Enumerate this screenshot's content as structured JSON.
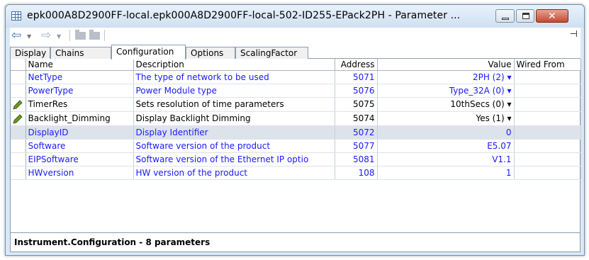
{
  "window": {
    "title": "epk000A8D2900FF-local.epk000A8D2900FF-local-502-ID255-EPack2PH - Parameter ...",
    "close_glyph": "✕"
  },
  "toolbar": {
    "back_glyph": "⇦",
    "forward_glyph": "⇨",
    "dropdown_glyph": "▼",
    "pin_glyph": "⊣"
  },
  "tabs": [
    {
      "label": "Display"
    },
    {
      "label": "Chains"
    },
    {
      "label": "Configuration"
    },
    {
      "label": "Options"
    },
    {
      "label": "ScalingFactor"
    }
  ],
  "active_tab": "Configuration",
  "table": {
    "columns": [
      "Name",
      "Description",
      "Address",
      "Value",
      "Wired From"
    ],
    "rows": [
      {
        "name": "NetType",
        "description": "The type of network to be used",
        "address": "5071",
        "value": "2PH (2) ▾",
        "wired_from": "",
        "editable": false,
        "color": "blue"
      },
      {
        "name": "PowerType",
        "description": "Power Module type",
        "address": "5076",
        "value": "Type_32A (0) ▾",
        "wired_from": "",
        "editable": false,
        "color": "blue"
      },
      {
        "name": "TimerRes",
        "description": "Sets resolution of time parameters",
        "address": "5075",
        "value": "10thSecs (0) ▾",
        "wired_from": "",
        "editable": true,
        "color": "black"
      },
      {
        "name": "Backlight_Dimming",
        "description": "Display Backlight Dimming",
        "address": "5074",
        "value": "Yes (1) ▾",
        "wired_from": "",
        "editable": true,
        "color": "black"
      },
      {
        "name": "DisplayID",
        "description": "Display Identifier",
        "address": "5072",
        "value": "0",
        "wired_from": "",
        "editable": false,
        "color": "blue"
      },
      {
        "name": "Software",
        "description": "Software version of the product",
        "address": "5077",
        "value": "E5.07",
        "wired_from": "",
        "editable": false,
        "color": "blue"
      },
      {
        "name": "EIPSoftware",
        "description": "Software version of the Ethernet IP optio",
        "address": "5081",
        "value": "V1.1",
        "wired_from": "",
        "editable": false,
        "color": "blue"
      },
      {
        "name": "HWversion",
        "description": "HW version of the product",
        "address": "108",
        "value": "1",
        "wired_from": "",
        "editable": false,
        "color": "blue"
      }
    ]
  },
  "status_bar": {
    "text": "Instrument.Configuration  -  8 parameters"
  },
  "colors": {
    "link_blue": "#1a1aff",
    "selected_row": "#dde3ea",
    "pencil_green": "#6a9a1f"
  }
}
